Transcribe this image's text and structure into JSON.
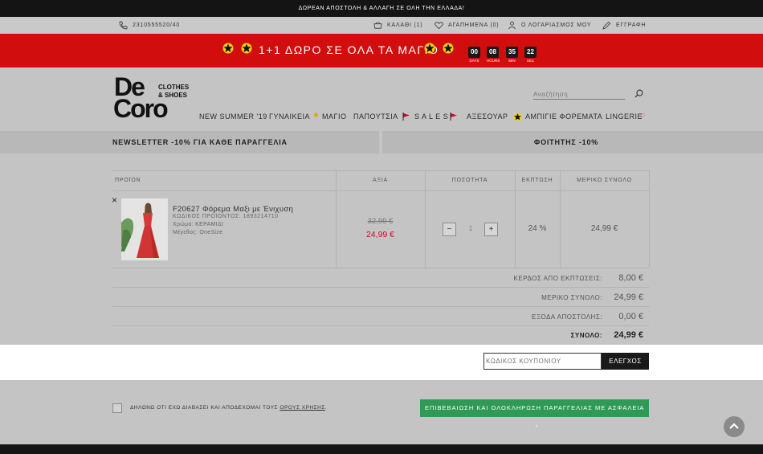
{
  "topbar": {
    "text": "ΔΩΡΕΑΝ ΑΠΟΣΤΟΛΗ & ΑΛΛΑΓΗ ΣΕ ΟΛΗ ΤΗΝ ΕΛΛΑΔΑ!"
  },
  "util": {
    "phone": "2310555520/40",
    "cart": "ΚΑΛΑΘΙ (1)",
    "favorites": "ΑΓΑΠΗΜΕΝΑ (0)",
    "account": "Ο ΛΟΓΑΡΙΑΣΜΟΣ ΜΟΥ",
    "register": "ΕΓΓΡΑΦΗ"
  },
  "promo": {
    "text": "1+1 ΔΩΡΟ ΣΕ ΟΛΑ ΤΑ ΜΑΓΙΟ",
    "countdown": [
      {
        "value": "00",
        "label": "DAYS"
      },
      {
        "value": "08",
        "label": "HOURS"
      },
      {
        "value": "35",
        "label": "MIN"
      },
      {
        "value": "22",
        "label": "SEC"
      }
    ]
  },
  "logo": {
    "line1": "De",
    "line2": "Coro",
    "tag1": "CLOTHES",
    "tag2": "& SHOES"
  },
  "search": {
    "placeholder": "Αναζήτηση"
  },
  "nav": {
    "new_summer": "NEW SUMMER '19",
    "women": "ΓΥΝΑΙΚΕΙΑ",
    "swim": "ΜΑΓΙΟ",
    "shoes": "ΠΑΠΟΥΤΣΙΑ",
    "sales": "S A L E S",
    "accessories": "ΑΞΕΣΟΥΑΡ",
    "evening": "ΑΜΠΙΓΙΕ ΦΟΡΕΜΑΤΑ",
    "lingerie": "LINGERIE"
  },
  "banners": {
    "newsletter": "NEWSLETTER -10% ΓΙΑ ΚΑΘΕ ΠΑΡΑΓΓΕΛΙΑ",
    "student": "ΦΟΙΤΗΤΗΣ -10%"
  },
  "table": {
    "headers": {
      "product": "ΠΡΟΪΟΝ",
      "value": "ΑΞΙΑ",
      "quantity": "ΠΟΣΟΤΗΤΑ",
      "discount": "ΕΚΠΤΩΣΗ",
      "subtotal": "ΜΕΡΙΚΟ ΣΥΝΟΛΟ"
    },
    "item": {
      "remove": "×",
      "name": "F20627 Φόρεμα Μαξι με Ένιχυση",
      "code": "ΚΩΔΙΚΟΣ ΠΡΟΪΟΝΤΟΣ: 1893214710",
      "color": "Χρώμα: ΚΕΡΑΜΙΔΙ",
      "size": "Μέγεθος: OneSize",
      "old_price": "32,99 €",
      "price": "24,99 €",
      "qty": "1",
      "minus": "−",
      "plus": "+",
      "discount": "24 %",
      "subtotal": "24,99 €"
    }
  },
  "summary": {
    "savings_label": "ΚΕΡΔΟΣ ΑΠΟ ΕΚΠΤΩΣΕΙΣ:",
    "savings": "8,00 €",
    "subtotal_label": "ΜΕΡΙΚΟ ΣΥΝΟΛΟ:",
    "subtotal": "24,99 €",
    "shipping_label": "ΕΞΟΔΑ ΑΠΟΣΤΟΛΗΣ:",
    "shipping": "0,00 €",
    "total_label": "ΣΥΝΟΛΟ:",
    "total": "24,99 €"
  },
  "coupon": {
    "placeholder": "ΚΩΔΙΚΟΣ ΚΟΥΠΟΝΙΟΥ",
    "button": "ΕΛΕΓΧΟΣ"
  },
  "terms": {
    "text": "ΔΗΛΩΝΩ ΟΤΙ ΕΧΩ ΔΙΑΒΑΣΕΙ ΚΑΙ ΑΠΟΔΕΧΟΜΑΙ ΤΟΥΣ",
    "link": "ΟΡΟΥΣ ΧΡΗΣΗΣ",
    "end": "."
  },
  "checkout": {
    "label": "ΕΠΙΒΕΒΑΙΩΣΗ ΚΑΙ ΟΛΟΚΛΗΡΩΣΗ ΠΑΡΑΓΓΕΛΙΑΣ ΜΕ ΑΣΦΑΛΕΙΑ"
  },
  "colors": {
    "promo": "#d10d0d",
    "checkout": "#2e9a55",
    "price_red": "#c4102a"
  }
}
